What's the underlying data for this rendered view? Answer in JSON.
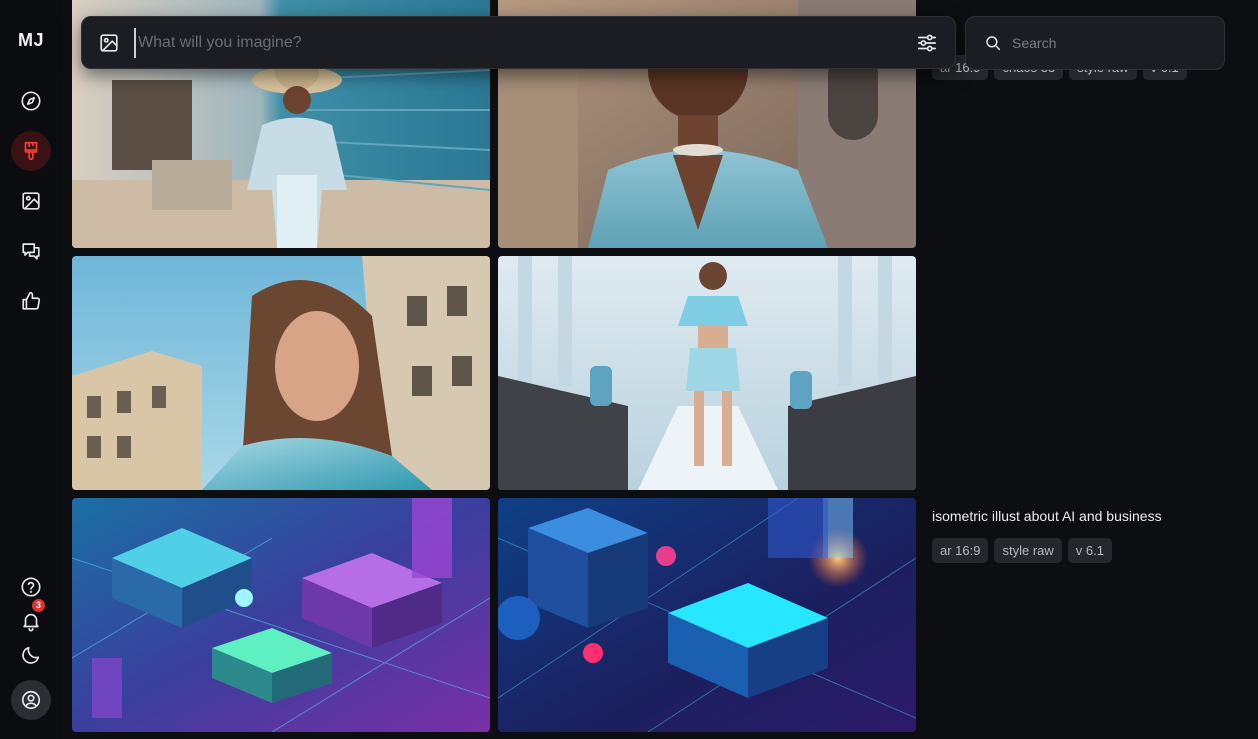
{
  "sidebar": {
    "logo": "MJ",
    "notification_count": "3",
    "items": [
      {
        "name": "explore",
        "icon": "compass-icon"
      },
      {
        "name": "create",
        "icon": "paintbrush-icon",
        "active": true
      },
      {
        "name": "organize",
        "icon": "image-icon"
      },
      {
        "name": "chat",
        "icon": "chat-bubbles-icon"
      },
      {
        "name": "rank",
        "icon": "thumbs-up-icon"
      }
    ],
    "bottom_items": [
      {
        "name": "help",
        "icon": "help-circle-icon"
      },
      {
        "name": "notifications",
        "icon": "bell-icon"
      },
      {
        "name": "dark-mode",
        "icon": "moon-icon"
      },
      {
        "name": "account",
        "icon": "user-circle-icon"
      }
    ]
  },
  "prompt": {
    "placeholder": "What will you imagine?",
    "value": ""
  },
  "search": {
    "placeholder": "Search",
    "value": ""
  },
  "jobs": [
    {
      "prompt": "",
      "params": [
        "ar 16:9",
        "chaos 33",
        "style raw",
        "v 6.1"
      ],
      "images": [
        "fashion-woman-sunhat",
        "fashion-woman-blazer-closeup",
        "fashion-woman-portrait-street",
        "fashion-runway-model"
      ]
    },
    {
      "prompt": "isometric illust about AI and business",
      "params": [
        "ar 16:9",
        "style raw",
        "v 6.1"
      ],
      "images": [
        "isometric-city-purple",
        "isometric-city-blue"
      ]
    }
  ],
  "colors": {
    "background": "#0d0e11",
    "accent_red": "#e0322f",
    "active_bg": "#3a1214",
    "chip_bg": "#25272c"
  }
}
